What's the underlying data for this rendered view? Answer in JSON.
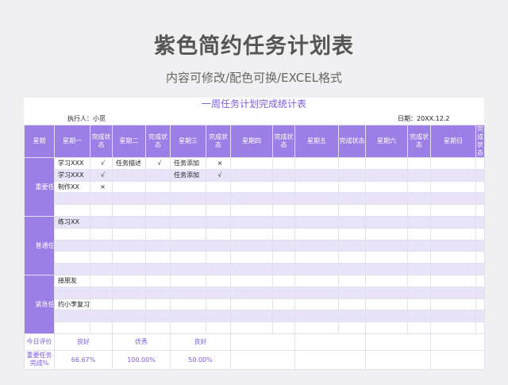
{
  "header": {
    "title": "紫色简约任务计划表",
    "subtitle": "内容可修改/配色可换/EXCEL格式"
  },
  "sheet": {
    "title": "一周任务计划完成统计表",
    "executor": "执行人：小觅",
    "date": "日期：20XX.12.2",
    "columns": [
      "星期",
      "星期一",
      "完成状态",
      "星期二",
      "完成状态",
      "星期三",
      "完成状态",
      "星期四",
      "完成状态",
      "星期五",
      "完成状态",
      "星期六",
      "完成状态",
      "星期日",
      "完成状态"
    ],
    "categories": [
      {
        "label": "重要任务"
      },
      {
        "label": "普通任务"
      },
      {
        "label": "紧急任务"
      }
    ],
    "rows": [
      [
        "学习XXX",
        "√",
        "任务描述",
        "√",
        "任务添加",
        "×",
        "",
        "",
        "",
        "",
        "",
        "",
        "",
        ""
      ],
      [
        "学习XXX",
        "√",
        "",
        "",
        "任务添加",
        "√",
        "",
        "",
        "",
        "",
        "",
        "",
        "",
        ""
      ],
      [
        "制作XX",
        "×",
        "",
        "",
        "",
        "",
        "",
        "",
        "",
        "",
        "",
        "",
        "",
        ""
      ],
      [
        "",
        "",
        "",
        "",
        "",
        "",
        "",
        "",
        "",
        "",
        "",
        "",
        "",
        ""
      ],
      [
        "",
        "",
        "",
        "",
        "",
        "",
        "",
        "",
        "",
        "",
        "",
        "",
        "",
        ""
      ],
      [
        "练习XX",
        "",
        "",
        "",
        "",
        "",
        "",
        "",
        "",
        "",
        "",
        "",
        "",
        ""
      ],
      [
        "",
        "",
        "",
        "",
        "",
        "",
        "",
        "",
        "",
        "",
        "",
        "",
        "",
        ""
      ],
      [
        "",
        "",
        "",
        "",
        "",
        "",
        "",
        "",
        "",
        "",
        "",
        "",
        "",
        ""
      ],
      [
        "",
        "",
        "",
        "",
        "",
        "",
        "",
        "",
        "",
        "",
        "",
        "",
        "",
        ""
      ],
      [
        "",
        "",
        "",
        "",
        "",
        "",
        "",
        "",
        "",
        "",
        "",
        "",
        "",
        ""
      ],
      [
        "接朋友",
        "",
        "",
        "",
        "",
        "",
        "",
        "",
        "",
        "",
        "",
        "",
        "",
        ""
      ],
      [
        "",
        "",
        "",
        "",
        "",
        "",
        "",
        "",
        "",
        "",
        "",
        "",
        "",
        ""
      ],
      [
        "约小李复习",
        "",
        "",
        "",
        "",
        "",
        "",
        "",
        "",
        "",
        "",
        "",
        "",
        ""
      ],
      [
        "",
        "",
        "",
        "",
        "",
        "",
        "",
        "",
        "",
        "",
        "",
        "",
        "",
        ""
      ],
      [
        "",
        "",
        "",
        "",
        "",
        "",
        "",
        "",
        "",
        "",
        "",
        "",
        "",
        ""
      ]
    ],
    "footer": {
      "eval_label": "今日评价",
      "eval_values": [
        "良好",
        "优秀",
        "良好"
      ],
      "rate_label": "重要任务完成%",
      "rate_values": [
        "66.67%",
        "100.00%",
        "50.00%"
      ]
    }
  },
  "colors": {
    "accent": "#9b7ee6",
    "accent_text": "#7b5ce0",
    "stripe": "#e8e3f8"
  }
}
